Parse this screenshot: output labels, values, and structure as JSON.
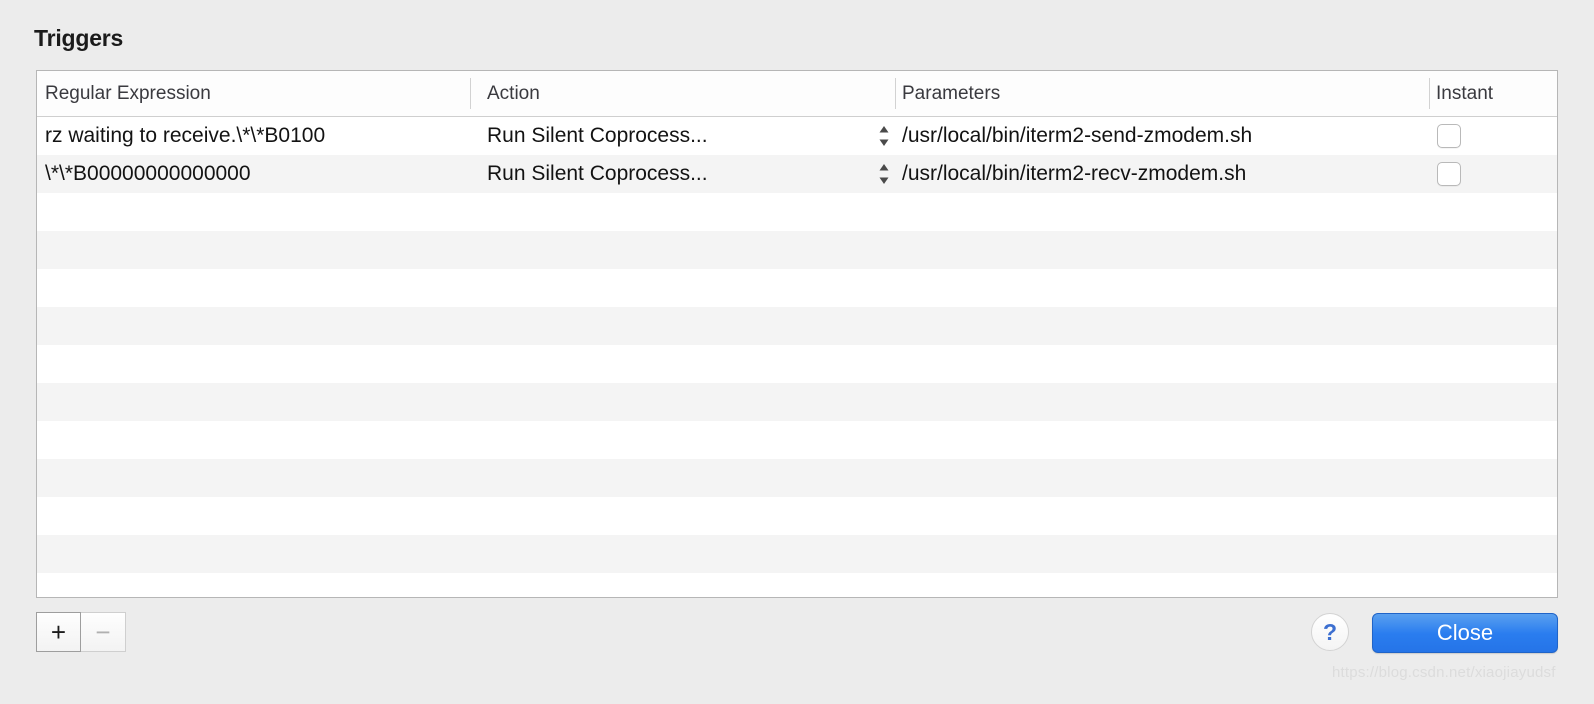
{
  "window": {
    "title": "Triggers",
    "background_color": "#ececec"
  },
  "table": {
    "columns": [
      {
        "key": "regex",
        "label": "Regular Expression"
      },
      {
        "key": "action",
        "label": "Action"
      },
      {
        "key": "params",
        "label": "Parameters"
      },
      {
        "key": "instant",
        "label": "Instant"
      }
    ],
    "rows": [
      {
        "regex": "rz waiting to receive.\\*\\*B0100",
        "action": "Run Silent Coprocess...",
        "params": "/usr/local/bin/iterm2-send-zmodem.sh",
        "instant": false,
        "stepper_icon": "stepper-updown-icon"
      },
      {
        "regex": "\\*\\*B00000000000000",
        "action": "Run Silent Coprocess...",
        "params": "/usr/local/bin/iterm2-recv-zmodem.sh",
        "instant": false,
        "stepper_icon": "stepper-updown-icon"
      }
    ],
    "empty_row_count": 12,
    "stripe_colors": {
      "odd": "#ffffff",
      "even": "#f4f4f4"
    }
  },
  "toolbar": {
    "add_label": "+",
    "add_icon": "plus-icon",
    "add_enabled": true,
    "remove_label": "−",
    "remove_icon": "minus-icon",
    "remove_enabled": false
  },
  "footer": {
    "help_label": "?",
    "help_icon": "question-mark-icon",
    "close_label": "Close",
    "close_accent_color": "#2a7def"
  },
  "watermark": {
    "text": "https://blog.csdn.net/xiaojiayudsf"
  }
}
